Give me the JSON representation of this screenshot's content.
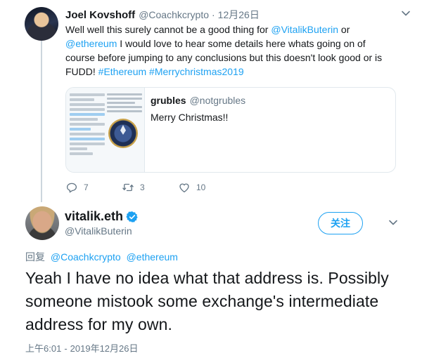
{
  "parent_tweet": {
    "author_name": "Joel Kovshoff",
    "author_handle": "@Coachkcrypto",
    "separator": "·",
    "date": "12月26日",
    "body": {
      "part1": "Well well this surely cannot be a good thing for ",
      "mention1": "@VitalikButerin",
      "part2": " or ",
      "mention2": "@ethereum",
      "part3": " I would love to hear some details here whats going on of course before jumping to any conclusions but this doesn't look good or is FUDD! ",
      "hashtag1": "#Ethereum",
      "part4": " ",
      "hashtag2": "#Merrychristmas2019"
    },
    "quoted": {
      "author_name": "grubles",
      "author_handle": "@notgrubles",
      "text": "Merry Christmas!!"
    },
    "actions": {
      "reply_count": "7",
      "retweet_count": "3",
      "like_count": "10"
    }
  },
  "main_tweet": {
    "author_name": "vitalik.eth",
    "author_handle": "@VitalikButerin",
    "follow_label": "关注",
    "reply_prefix": "回复",
    "reply_mention1": "@Coachkcrypto",
    "reply_mention2": "@ethereum",
    "text": "Yeah I have no idea what that address is. Possibly someone mistook some exchange's intermediate address for my own.",
    "time": "上午6:01",
    "time_separator": "-",
    "date": "2019年12月26日"
  },
  "colors": {
    "accent": "#1da1f2",
    "secondary_text": "#657786",
    "primary_text": "#14171a",
    "border": "#e1e8ed"
  },
  "icons": [
    "reply-icon",
    "retweet-icon",
    "like-icon",
    "verified-icon",
    "chevron-down-icon"
  ]
}
